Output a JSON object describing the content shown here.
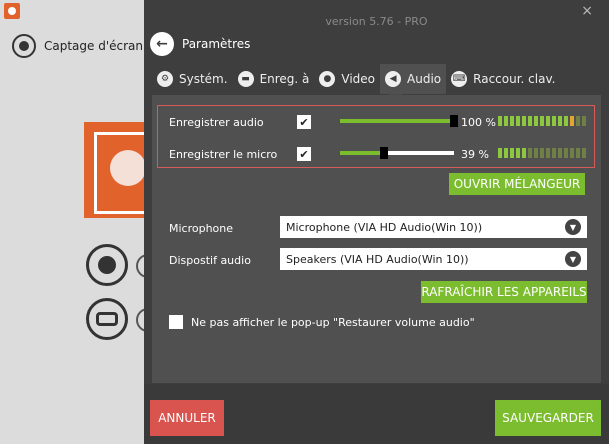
{
  "background_app": {
    "capture_mode_label": "Captage d'écran",
    "brand_color": "#e2622c"
  },
  "window": {
    "version": "version 5.76 - PRO",
    "close_icon": "×"
  },
  "header": {
    "back_icon": "←",
    "title": "Paramètres"
  },
  "tabs": [
    {
      "label": "Systém.",
      "icon": "gear-icon",
      "glyph": "⚙",
      "active": false
    },
    {
      "label": "Enreg. à",
      "icon": "folder-icon",
      "glyph": "▬",
      "active": false
    },
    {
      "label": "Video",
      "icon": "record-icon",
      "glyph": "●",
      "active": false
    },
    {
      "label": "Audio",
      "icon": "speaker-icon",
      "glyph": "◀",
      "active": true
    },
    {
      "label": "Raccour. clav.",
      "icon": "keyboard-icon",
      "glyph": "⌨",
      "active": false
    }
  ],
  "audio": {
    "record_audio": {
      "label": "Enregistrer audio",
      "checked": true,
      "check_glyph": "✔",
      "volume": 100,
      "value_text": "100 %",
      "meter_level": 0.85
    },
    "record_mic": {
      "label": "Enregistrer le micro",
      "checked": true,
      "check_glyph": "✔",
      "volume": 39,
      "value_text": "39 %",
      "meter_level": 0.35
    },
    "mixer_button": "OUVRIR MÉLANGEUR",
    "microphone": {
      "label": "Microphone",
      "value": "Microphone (VIA HD Audio(Win 10))"
    },
    "audio_device": {
      "label": "Dispostif audio",
      "value": "Speakers (VIA HD Audio(Win 10))"
    },
    "refresh_button": "RAFRAÎCHIR LES APPAREILS",
    "no_popup": {
      "label": "Ne pas afficher le pop-up \"Restaurer volume audio\"",
      "checked": false
    }
  },
  "footer": {
    "cancel": "ANNULER",
    "save": "SAUVEGARDER"
  },
  "colors": {
    "panel_bg": "#3e3e3e",
    "content_bg": "#505050",
    "accent_green": "#7cbd2f",
    "cancel_red": "#d9534f",
    "highlight_border": "#d85a5a"
  }
}
